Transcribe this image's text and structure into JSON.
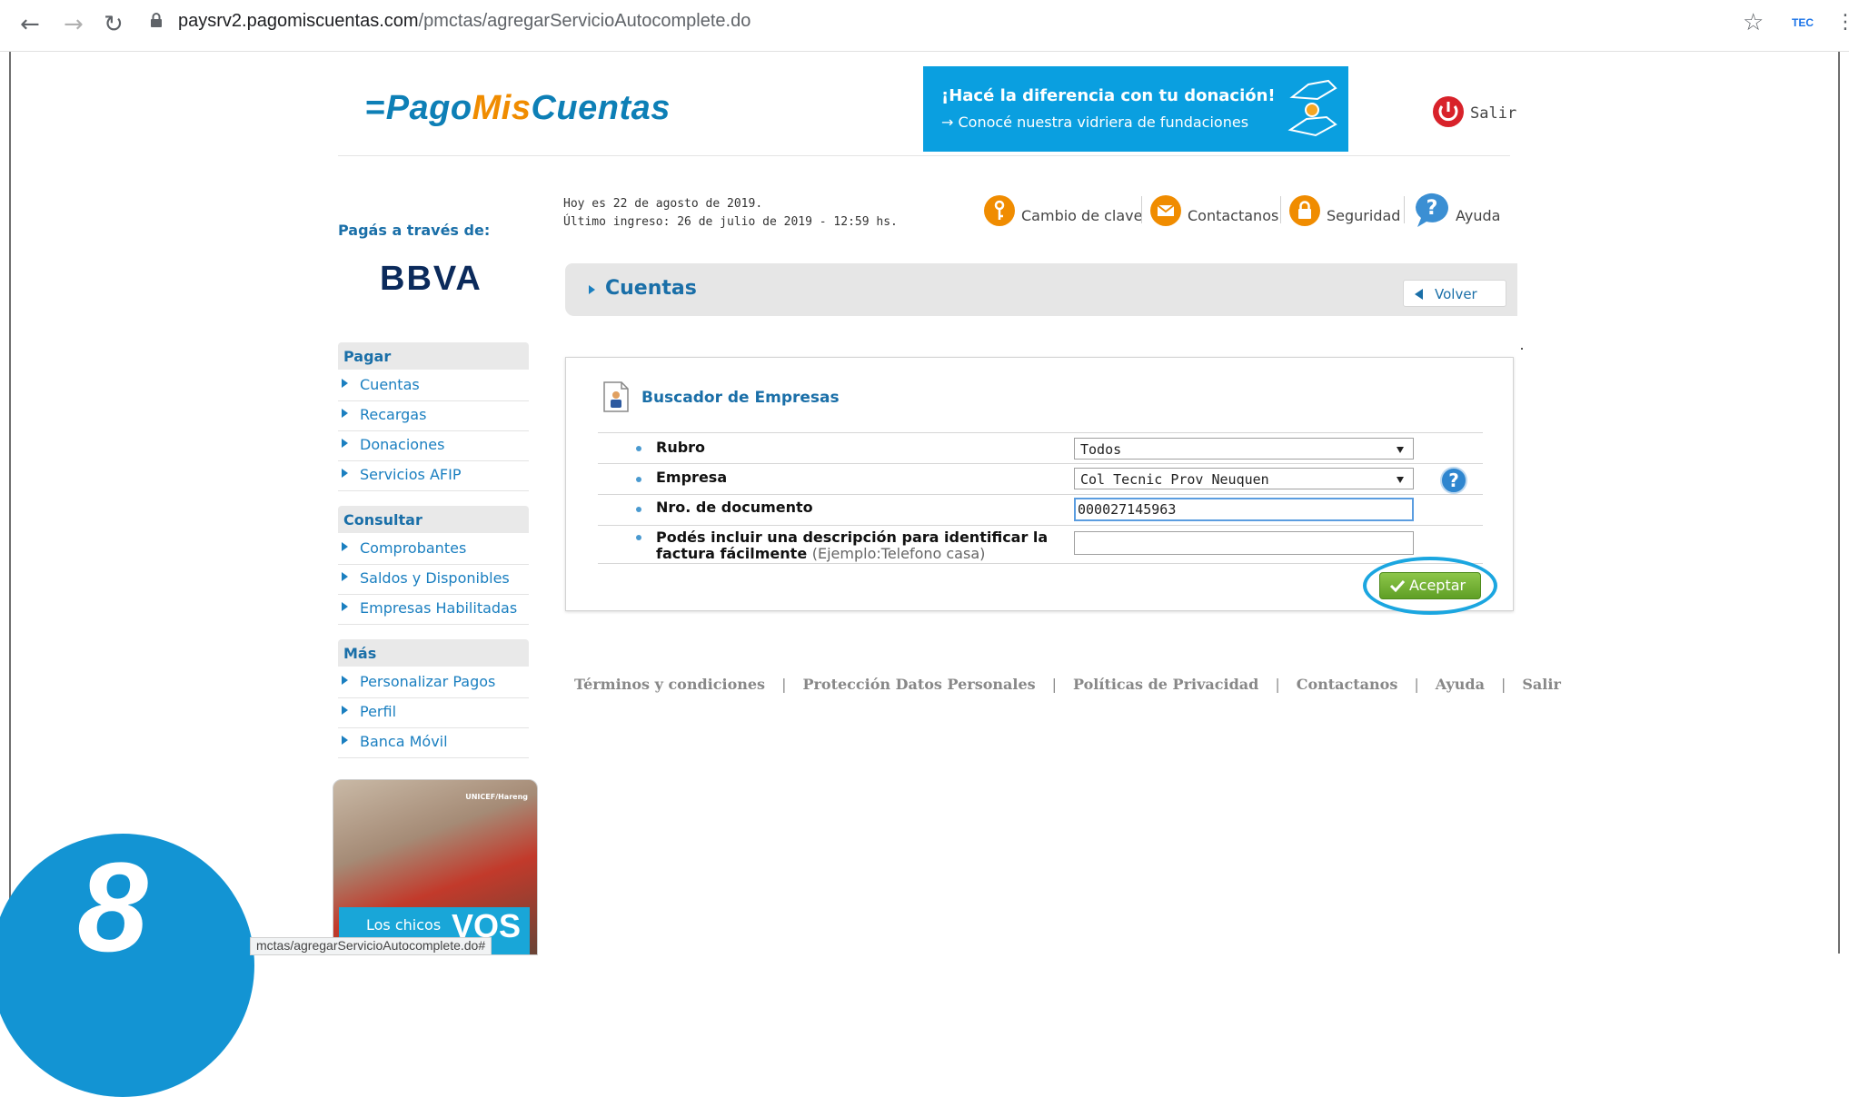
{
  "browser": {
    "url_domain": "paysrv2.pagomiscuentas.com",
    "url_path": "/pmctas/agregarServicioAutocomplete.do",
    "extension_label": "TEC"
  },
  "header": {
    "logo_prefix": "Pago",
    "logo_mid": "Mis",
    "logo_suffix": "Cuentas",
    "banner_line1": "¡Hacé la diferencia con tu donación!",
    "banner_line2": "→ Conocé nuestra vidriera de fundaciones",
    "salir_label": "Salir"
  },
  "sidebar": {
    "pagas_label": "Pagás a través de:",
    "bank": "BBVA",
    "sections": [
      {
        "title": "Pagar",
        "items": [
          "Cuentas",
          "Recargas",
          "Donaciones",
          "Servicios AFIP"
        ]
      },
      {
        "title": "Consultar",
        "items": [
          "Comprobantes",
          "Saldos y Disponibles",
          "Empresas Habilitadas"
        ]
      },
      {
        "title": "Más",
        "items": [
          "Personalizar Pagos",
          "Perfil",
          "Banca Móvil"
        ]
      }
    ],
    "promo_source": "UNICEF/Hareng",
    "promo_text": "Los chicos",
    "promo_big": "VOS"
  },
  "info": {
    "today": "Hoy es 22 de agosto de 2019.",
    "last_login": "Último ingreso: 26 de julio de 2019 - 12:59 hs."
  },
  "toolbar": {
    "cambio_clave": "Cambio de clave",
    "contactanos": "Contactanos",
    "seguridad": "Seguridad",
    "ayuda": "Ayuda"
  },
  "section": {
    "title": "Cuentas",
    "volver": "Volver"
  },
  "buscador": {
    "title": "Buscador de Empresas",
    "rubro_label": "Rubro",
    "rubro_value": "Todos",
    "empresa_label": "Empresa",
    "empresa_value": "Col Tecnic Prov Neuquen",
    "documento_label": "Nro. de documento",
    "documento_value": "000027145963",
    "descripcion_label": "Podés incluir una descripción para identificar la factura fácilmente",
    "descripcion_example": "(Ejemplo:Telefono casa)",
    "descripcion_value": "",
    "aceptar": "Aceptar"
  },
  "footer": {
    "links": [
      "Términos y condiciones",
      "Protección Datos Personales",
      "Políticas de Privacidad",
      "Contactanos",
      "Ayuda",
      "Salir"
    ]
  },
  "overlay": {
    "step_number": "8",
    "status_url": "mctas/agregarServicioAutocomplete.do#"
  },
  "colors": {
    "brand_blue": "#0d7fb6",
    "brand_orange": "#f08c00",
    "link_blue": "#1a7fc0",
    "accept_green": "#6db22f",
    "highlight_ring": "#1ba6e0"
  }
}
